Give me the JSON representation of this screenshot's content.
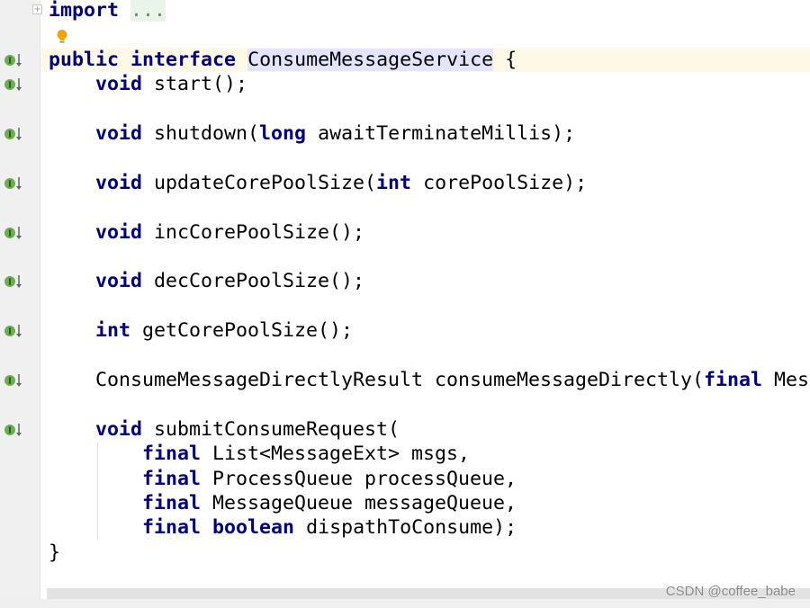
{
  "lines": [
    {
      "tokens": [
        {
          "text": "import",
          "k": "kw"
        },
        {
          "text": " "
        },
        {
          "text": "...",
          "k": "fold"
        }
      ]
    },
    {
      "tokens": []
    },
    {
      "current": true,
      "icon": "implemented-interface-icon",
      "tokens": [
        {
          "text": "public",
          "k": "kw"
        },
        {
          "text": " "
        },
        {
          "text": "interface",
          "k": "kw"
        },
        {
          "text": " "
        },
        {
          "text": "ConsumeMessageService",
          "k": "hl"
        },
        {
          "text": " {"
        }
      ]
    },
    {
      "icon": "implemented-method-icon",
      "tokens": [
        {
          "text": "    "
        },
        {
          "text": "void",
          "k": "kw"
        },
        {
          "text": " start();"
        }
      ]
    },
    {
      "tokens": []
    },
    {
      "icon": "implemented-method-icon",
      "tokens": [
        {
          "text": "    "
        },
        {
          "text": "void",
          "k": "kw"
        },
        {
          "text": " shutdown("
        },
        {
          "text": "long",
          "k": "kw"
        },
        {
          "text": " awaitTerminateMillis);"
        }
      ]
    },
    {
      "tokens": []
    },
    {
      "icon": "implemented-method-icon",
      "tokens": [
        {
          "text": "    "
        },
        {
          "text": "void",
          "k": "kw"
        },
        {
          "text": " updateCorePoolSize("
        },
        {
          "text": "int",
          "k": "kw"
        },
        {
          "text": " corePoolSize);"
        }
      ]
    },
    {
      "tokens": []
    },
    {
      "icon": "implemented-method-icon",
      "tokens": [
        {
          "text": "    "
        },
        {
          "text": "void",
          "k": "kw"
        },
        {
          "text": " incCorePoolSize();"
        }
      ]
    },
    {
      "tokens": []
    },
    {
      "icon": "implemented-method-icon",
      "tokens": [
        {
          "text": "    "
        },
        {
          "text": "void",
          "k": "kw"
        },
        {
          "text": " decCorePoolSize();"
        }
      ]
    },
    {
      "tokens": []
    },
    {
      "icon": "implemented-method-icon",
      "tokens": [
        {
          "text": "    "
        },
        {
          "text": "int",
          "k": "kw"
        },
        {
          "text": " getCorePoolSize();"
        }
      ]
    },
    {
      "tokens": []
    },
    {
      "icon": "implemented-method-icon",
      "tokens": [
        {
          "text": "    ConsumeMessageDirectlyResult consumeMessageDirectly("
        },
        {
          "text": "final",
          "k": "kw"
        },
        {
          "text": " Mes"
        }
      ]
    },
    {
      "tokens": []
    },
    {
      "icon": "implemented-method-icon",
      "tokens": [
        {
          "text": "    "
        },
        {
          "text": "void",
          "k": "kw"
        },
        {
          "text": " submitConsumeRequest("
        }
      ]
    },
    {
      "tokens": [
        {
          "text": "        "
        },
        {
          "text": "final",
          "k": "kw"
        },
        {
          "text": " List<MessageExt> msgs,"
        }
      ]
    },
    {
      "tokens": [
        {
          "text": "        "
        },
        {
          "text": "final",
          "k": "kw"
        },
        {
          "text": " ProcessQueue processQueue,"
        }
      ]
    },
    {
      "tokens": [
        {
          "text": "        "
        },
        {
          "text": "final",
          "k": "kw"
        },
        {
          "text": " MessageQueue messageQueue,"
        }
      ]
    },
    {
      "tokens": [
        {
          "text": "        "
        },
        {
          "text": "final",
          "k": "kw"
        },
        {
          "text": " "
        },
        {
          "text": "boolean",
          "k": "kw"
        },
        {
          "text": " dispathToConsume);"
        }
      ]
    },
    {
      "tokens": [
        {
          "text": "}"
        }
      ]
    }
  ],
  "watermark": "CSDN @coffee_babe",
  "colors": {
    "keyword": "#000080",
    "current_line": "#fdf9e6",
    "gutter": "#f0f0f0",
    "gutter_icon": "#6aaf50",
    "bulb": "#f0a30a"
  }
}
